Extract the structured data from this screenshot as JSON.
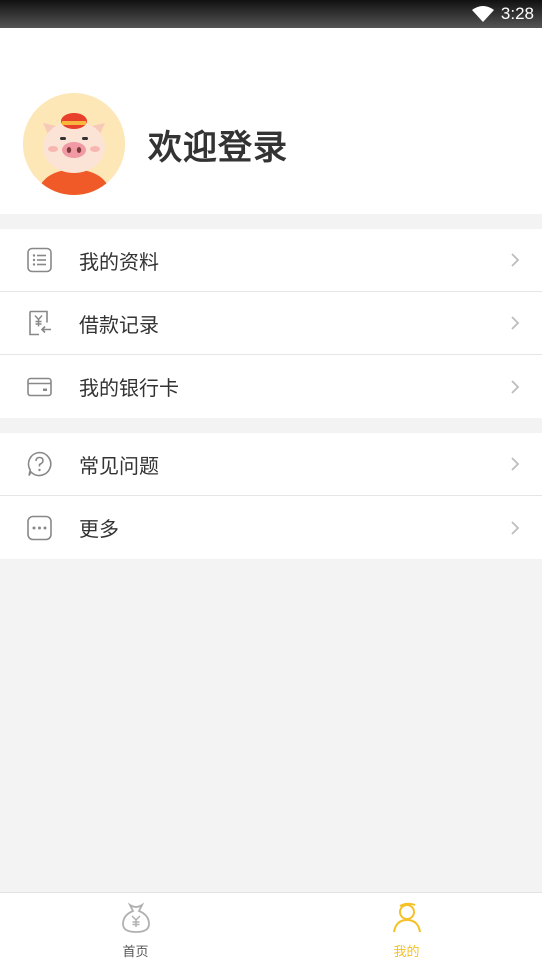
{
  "status_bar": {
    "time": "3:28"
  },
  "profile": {
    "welcome_text": "欢迎登录"
  },
  "menu_group_1": [
    {
      "label": "我的资料",
      "icon": "profile-list-icon"
    },
    {
      "label": "借款记录",
      "icon": "loan-record-icon"
    },
    {
      "label": "我的银行卡",
      "icon": "bank-card-icon"
    }
  ],
  "menu_group_2": [
    {
      "label": "常见问题",
      "icon": "faq-icon"
    },
    {
      "label": "更多",
      "icon": "more-icon"
    }
  ],
  "tabbar": {
    "tabs": [
      {
        "label": "首页",
        "icon": "money-bag-icon",
        "active": false
      },
      {
        "label": "我的",
        "icon": "user-icon",
        "active": true
      }
    ]
  },
  "colors": {
    "accent": "#f5c127",
    "icon_gray": "#888888",
    "chevron": "#bdbdbd"
  }
}
